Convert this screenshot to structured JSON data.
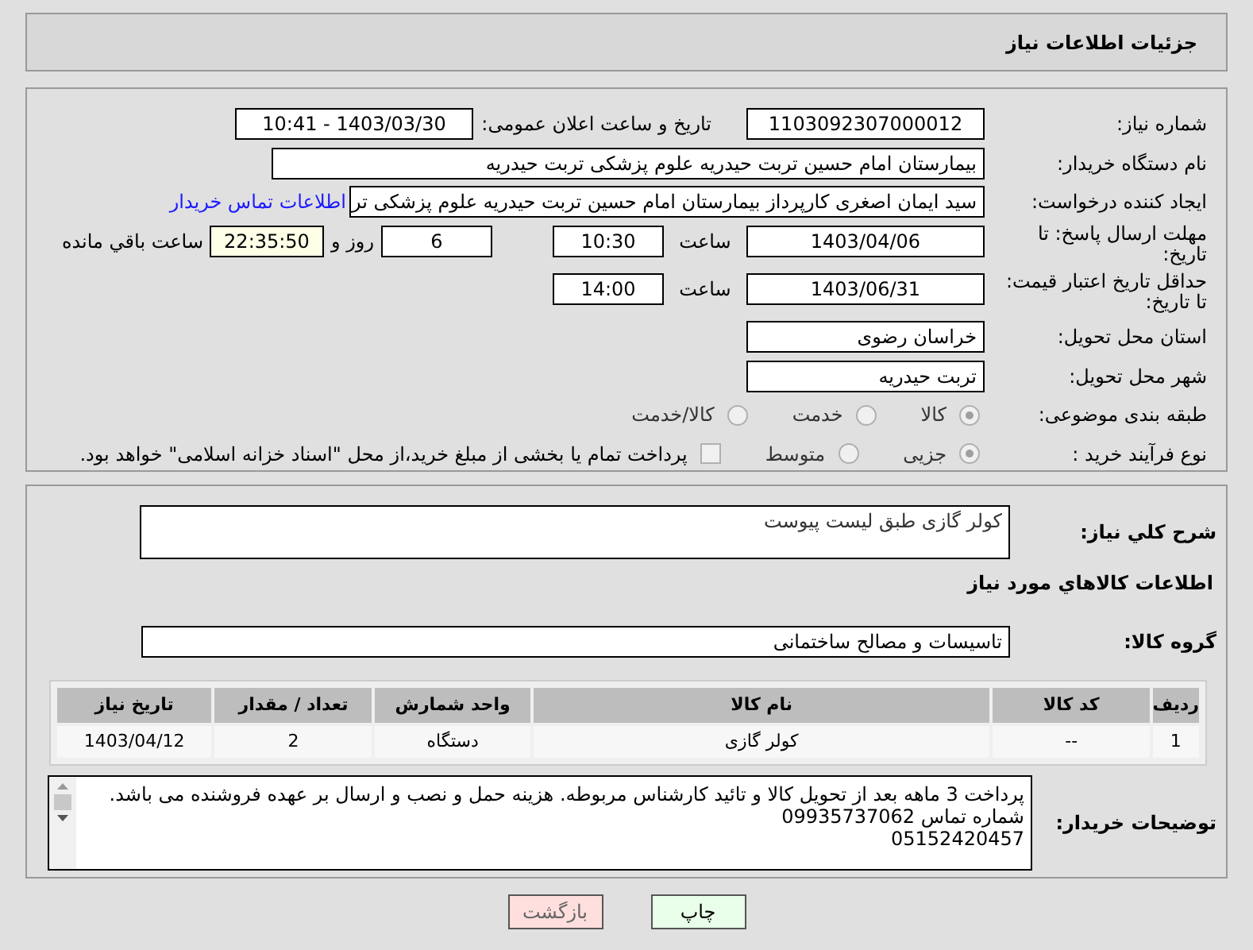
{
  "header": {
    "title": "جزئیات اطلاعات نیاز"
  },
  "need_number": {
    "label": "شماره نیاز:",
    "value": "1103092307000012"
  },
  "announce": {
    "label": "تاریخ و ساعت اعلان عمومی:",
    "value": "1403/03/30 - 10:41"
  },
  "buyer_org": {
    "label": "نام دستگاه خریدار:",
    "value": "بیمارستان امام حسین تربت حیدریه   علوم پزشکی تربت حیدریه"
  },
  "requester": {
    "label": "ایجاد کننده درخواست:",
    "value": "سید ایمان اصغری کارپرداز بیمارستان امام حسین تربت حیدریه   علوم پزشکی تر",
    "link": "اطلاعات تماس خریدار"
  },
  "deadline": {
    "label": "مهلت ارسال پاسخ: تا تاریخ:",
    "date": "1403/04/06",
    "time_label": "ساعت",
    "time": "10:30",
    "days": "6",
    "days_label": "روز و",
    "remaining": "22:35:50",
    "remaining_label": "ساعت باقي مانده"
  },
  "validity": {
    "label": "حداقل تاریخ اعتبار قیمت: تا تاریخ:",
    "date": "1403/06/31",
    "time_label": "ساعت",
    "time": "14:00"
  },
  "province": {
    "label": "استان محل تحویل:",
    "value": "خراسان رضوی"
  },
  "city": {
    "label": "شهر محل تحویل:",
    "value": "تربت حیدریه"
  },
  "category": {
    "label": "طبقه بندی موضوعی:",
    "options": [
      {
        "label": "کالا",
        "selected": true
      },
      {
        "label": "خدمت",
        "selected": false
      },
      {
        "label": "کالا/خدمت",
        "selected": false
      }
    ]
  },
  "process": {
    "label": "نوع فرآیند خرید :",
    "options": [
      {
        "label": "جزیی",
        "selected": true
      },
      {
        "label": "متوسط",
        "selected": false
      }
    ],
    "treasury": {
      "label": "پرداخت تمام یا بخشی از مبلغ خرید،از محل \"اسناد خزانه اسلامی\" خواهد بود.",
      "checked": false
    }
  },
  "description": {
    "label": "شرح کلي نياز:",
    "value": "کولر گازی طبق لیست پیوست"
  },
  "goods_heading": "اطلاعات کالاهاي مورد نياز",
  "goods_group": {
    "label": "گروه کالا:",
    "value": "تاسیسات و مصالح ساختمانی"
  },
  "table": {
    "columns": [
      "رديف",
      "کد کالا",
      "نام کالا",
      "واحد شمارش",
      "تعداد / مقدار",
      "تاریخ نیاز"
    ],
    "rows": [
      [
        "1",
        "--",
        "کولر گازی",
        "دستگاه",
        "2",
        "1403/04/12"
      ]
    ]
  },
  "buyer_notes": {
    "label": "توضیحات خریدار:",
    "lines": [
      "پرداخت 3 ماهه بعد از تحویل کالا و تائید کارشناس مربوطه. هزینه حمل و نصب و ارسال بر عهده فروشنده می باشد.",
      "شماره تماس 09935737062",
      "05152420457"
    ]
  },
  "buttons": [
    {
      "label": "چاپ",
      "kind": "print"
    },
    {
      "label": "بازگشت",
      "kind": "back"
    }
  ]
}
